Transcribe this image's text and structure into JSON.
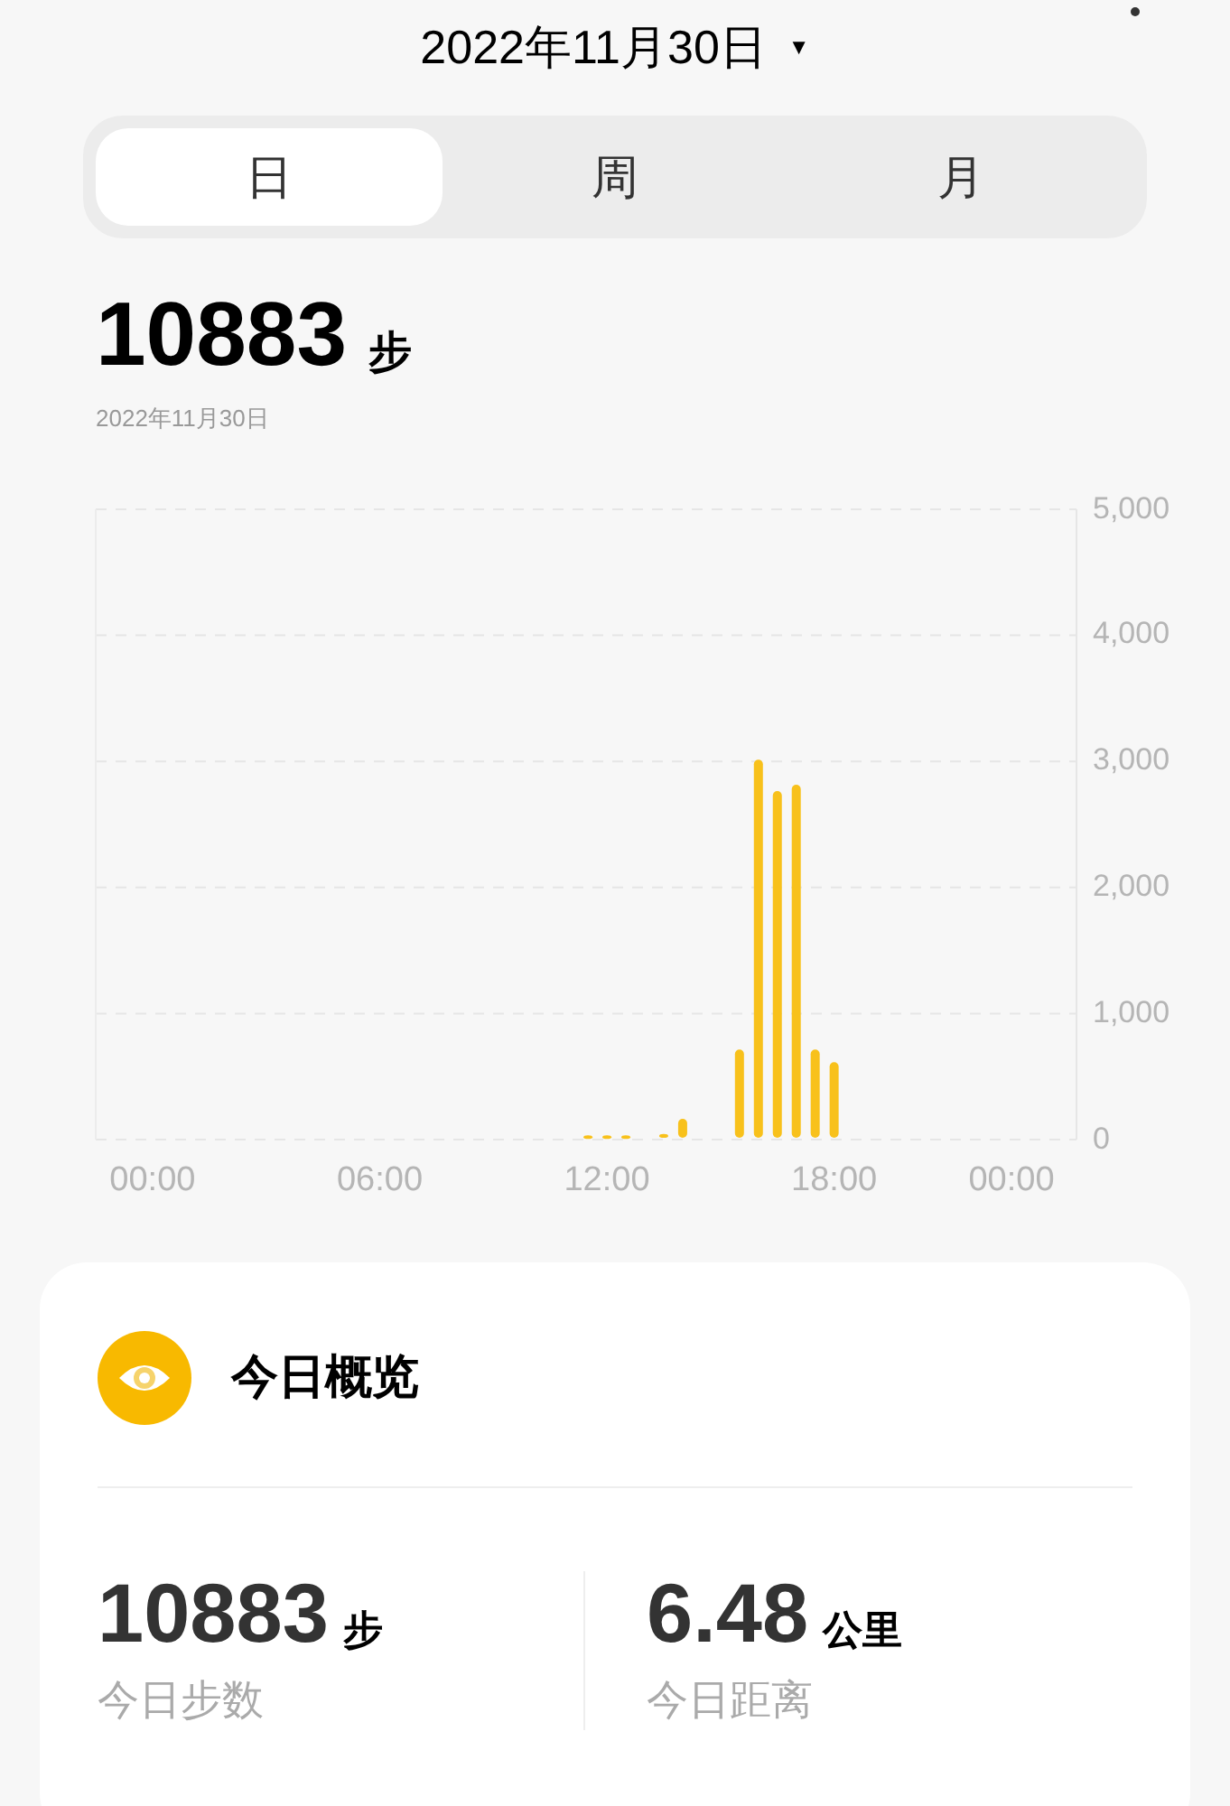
{
  "header": {
    "date": "2022年11月30日",
    "dropdown_arrow": "▼"
  },
  "tabs": [
    {
      "label": "日",
      "selected": true
    },
    {
      "label": "周",
      "selected": false
    },
    {
      "label": "月",
      "selected": false
    }
  ],
  "summary": {
    "value": "10883",
    "unit": "步",
    "date": "2022年11月30日"
  },
  "chart_data": {
    "type": "bar",
    "x": [
      11.5,
      12,
      12.5,
      13.5,
      14,
      15.5,
      16,
      16.5,
      17,
      17.5,
      18
    ],
    "values": [
      20,
      20,
      20,
      30,
      150,
      700,
      3000,
      2750,
      2800,
      700,
      600
    ],
    "grid": true,
    "color": "#f8c11b",
    "xlim": [
      -1.5,
      24.4
    ],
    "ylim": [
      0,
      5000
    ],
    "xticks": [
      {
        "value": 0,
        "label": "00:00"
      },
      {
        "value": 6,
        "label": "06:00"
      },
      {
        "value": 12,
        "label": "12:00"
      },
      {
        "value": 18,
        "label": "18:00"
      },
      {
        "value": 24,
        "label": "00:00"
      }
    ],
    "yticks": [
      {
        "value": 0,
        "label": "0"
      },
      {
        "value": 1000,
        "label": "1,000"
      },
      {
        "value": 2000,
        "label": "2,000"
      },
      {
        "value": 3000,
        "label": "3,000"
      },
      {
        "value": 4000,
        "label": "4,000"
      },
      {
        "value": 5000,
        "label": "5,000"
      }
    ]
  },
  "overview": {
    "title": "今日概览",
    "stats": [
      {
        "value": "10883",
        "unit": "步",
        "label": "今日步数"
      },
      {
        "value": "6.48",
        "unit": "公里",
        "label": "今日距离"
      }
    ]
  }
}
